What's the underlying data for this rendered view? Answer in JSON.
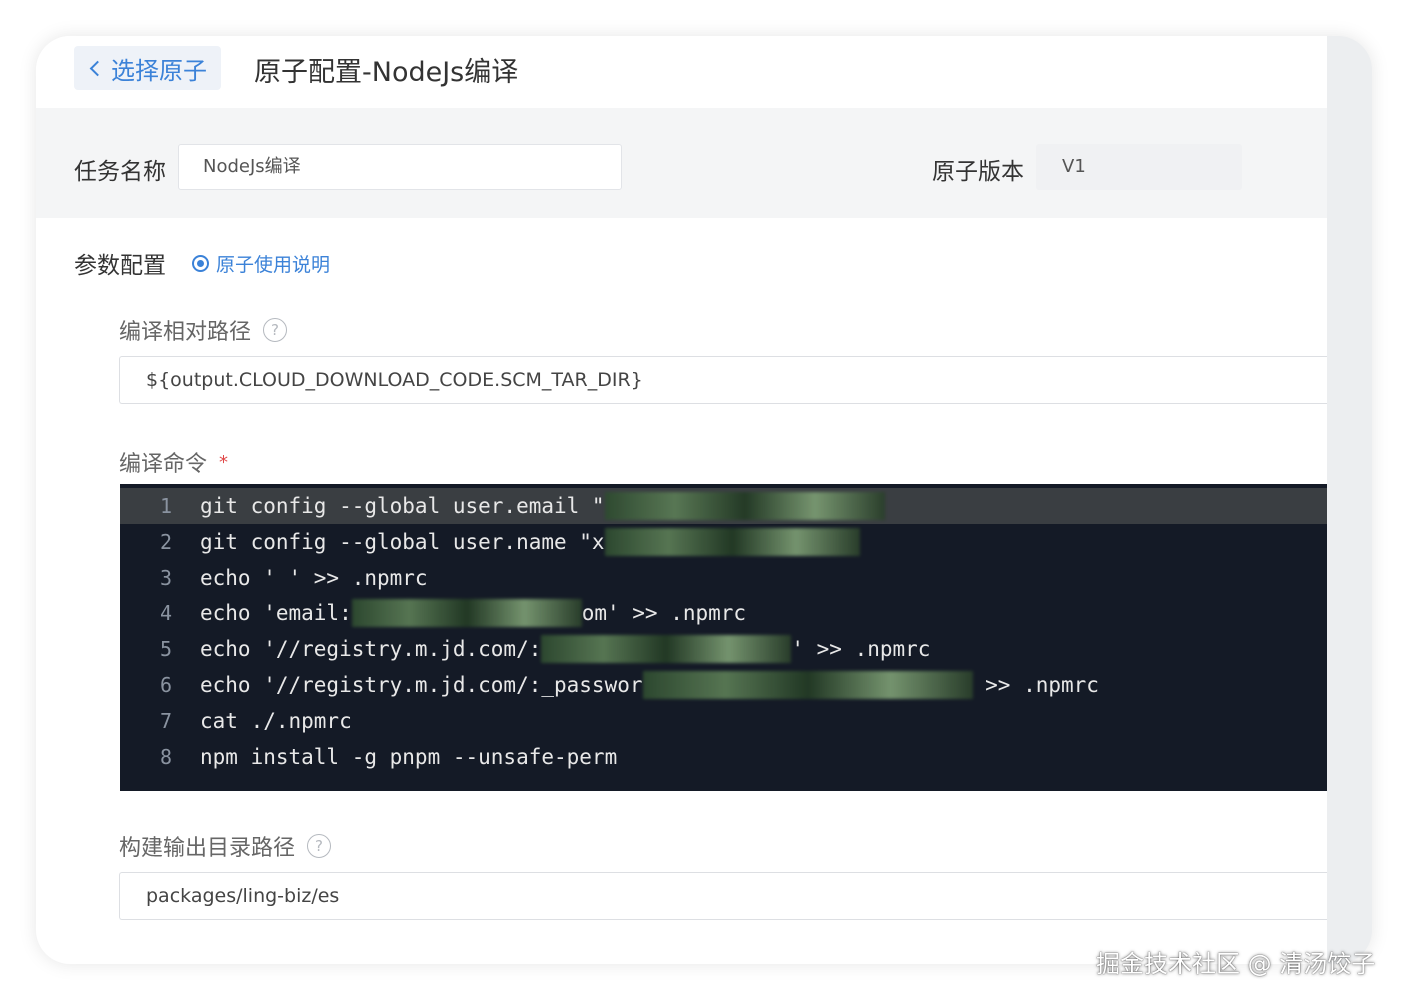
{
  "header": {
    "back_label": "选择原子",
    "title": "原子配置-NodeJs编译"
  },
  "task": {
    "name_label": "任务名称",
    "name_value": "NodeJs编译",
    "version_label": "原子版本",
    "version_value": "V1"
  },
  "params": {
    "section_title": "参数配置",
    "help_link": "原子使用说明",
    "relative_path_label": "编译相对路径",
    "relative_path_value": "${output.CLOUD_DOWNLOAD_CODE.SCM_TAR_DIR}",
    "command_label": "编译命令",
    "required_mark": "*",
    "output_dir_label": "构建输出目录路径",
    "output_dir_value": "packages/ling-biz/es"
  },
  "editor": {
    "lines": [
      {
        "num": "1",
        "text": "git config --global user.email \""
      },
      {
        "num": "2",
        "text": "git config --global user.name \"x"
      },
      {
        "num": "3",
        "text": "echo ' ' >> .npmrc"
      },
      {
        "num": "4",
        "text": "echo 'email:",
        "tail": "om' >> .npmrc"
      },
      {
        "num": "5",
        "text": "echo '//registry.m.jd.com/:",
        "tail": "' >> .npmrc"
      },
      {
        "num": "6",
        "text": "echo '//registry.m.jd.com/:_passwor",
        "tail": " >> .npmrc"
      },
      {
        "num": "7",
        "text": "cat ./.npmrc"
      },
      {
        "num": "8",
        "text": "npm install -g pnpm --unsafe-perm"
      }
    ]
  },
  "watermark": "掘金技术社区 @ 清汤饺子",
  "icons": {
    "back": "chevron-left-icon",
    "help": "circle-dot-icon",
    "question": "question-circle-icon"
  },
  "colors": {
    "accent": "#3b82d8",
    "editor_bg": "#141a26",
    "required": "#e04848"
  }
}
